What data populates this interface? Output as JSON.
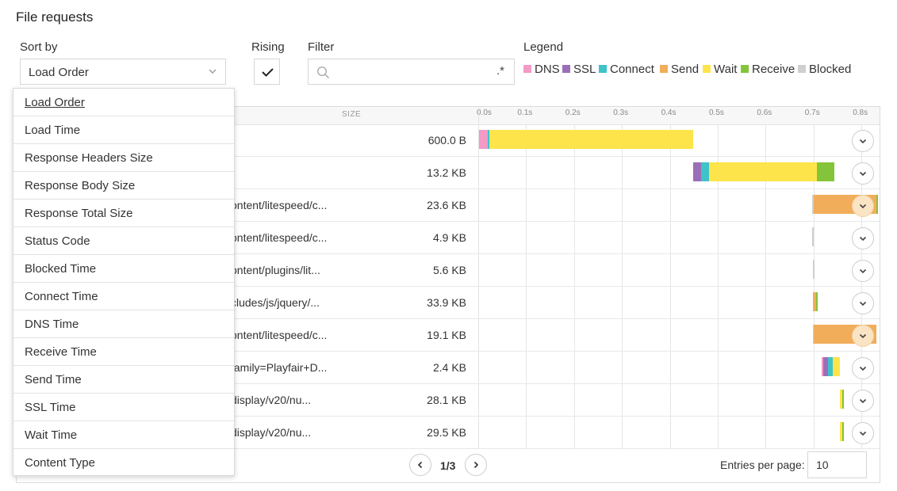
{
  "page": {
    "title": "File requests"
  },
  "controls": {
    "sort_label": "Sort by",
    "sort_value": "Load Order",
    "rising_label": "Rising",
    "rising_checked": true,
    "filter_label": "Filter",
    "filter_value": "",
    "filter_regex": ".*",
    "legend_label": "Legend"
  },
  "legend": [
    {
      "label": "DNS",
      "color": "#f39ac7"
    },
    {
      "label": "SSL",
      "color": "#9b6fb8"
    },
    {
      "label": "Connect",
      "color": "#3ec3c9"
    },
    {
      "label": "Send",
      "color": "#f2ad5a"
    },
    {
      "label": "Wait",
      "color": "#fde44a"
    },
    {
      "label": "Receive",
      "color": "#84c43a"
    },
    {
      "label": "Blocked",
      "color": "#cfcfcf"
    }
  ],
  "table": {
    "size_header": "SIZE",
    "ticks": [
      "0.0s",
      "0.1s",
      "0.2s",
      "0.3s",
      "0.4s",
      "0.5s",
      "0.6s",
      "0.7s",
      "0.8s"
    ],
    "rows": [
      {
        "url": "",
        "size": "600.0 B",
        "highlight": false,
        "timing": [
          {
            "phase": "DNS",
            "start": 0.0,
            "end": 0.018
          },
          {
            "phase": "Connect",
            "start": 0.018,
            "end": 0.021
          },
          {
            "phase": "Wait",
            "start": 0.021,
            "end": 0.447
          }
        ]
      },
      {
        "url": "",
        "size": "13.2 KB",
        "highlight": false,
        "timing": [
          {
            "phase": "SSL",
            "start": 0.447,
            "end": 0.463
          },
          {
            "phase": "Connect",
            "start": 0.463,
            "end": 0.48
          },
          {
            "phase": "Wait",
            "start": 0.48,
            "end": 0.705
          },
          {
            "phase": "Receive",
            "start": 0.705,
            "end": 0.742
          }
        ]
      },
      {
        "url": "ontent/litespeed/c...",
        "size": "23.6 KB",
        "highlight": true,
        "timing": [
          {
            "phase": "Blocked",
            "start": 0.696,
            "end": 0.698
          },
          {
            "phase": "Send",
            "start": 0.698,
            "end": 0.83
          },
          {
            "phase": "Receive",
            "start": 0.83,
            "end": 0.832
          }
        ]
      },
      {
        "url": "ontent/litespeed/c...",
        "size": "4.9 KB",
        "highlight": false,
        "timing": [
          {
            "phase": "Blocked",
            "start": 0.696,
            "end": 0.699
          }
        ]
      },
      {
        "url": "ontent/plugins/lit...",
        "size": "5.6 KB",
        "highlight": false,
        "timing": [
          {
            "phase": "Blocked",
            "start": 0.697,
            "end": 0.7
          }
        ]
      },
      {
        "url": "cludes/js/jquery/...",
        "size": "33.9 KB",
        "highlight": false,
        "timing": [
          {
            "phase": "Send",
            "start": 0.697,
            "end": 0.703
          },
          {
            "phase": "Receive",
            "start": 0.703,
            "end": 0.706
          }
        ]
      },
      {
        "url": "ontent/litespeed/c...",
        "size": "19.1 KB",
        "highlight": true,
        "timing": [
          {
            "phase": "Blocked",
            "start": 0.697,
            "end": 0.699
          },
          {
            "phase": "Send",
            "start": 0.699,
            "end": 0.83
          }
        ]
      },
      {
        "url": "family=Playfair+D...",
        "size": "2.4 KB",
        "highlight": false,
        "timing": [
          {
            "phase": "DNS",
            "start": 0.715,
            "end": 0.719
          },
          {
            "phase": "SSL",
            "start": 0.719,
            "end": 0.728
          },
          {
            "phase": "Connect",
            "start": 0.728,
            "end": 0.739
          },
          {
            "phase": "Wait",
            "start": 0.739,
            "end": 0.753
          }
        ]
      },
      {
        "url": "display/v20/nu...",
        "size": "28.1 KB",
        "highlight": false,
        "timing": [
          {
            "phase": "Wait",
            "start": 0.753,
            "end": 0.759
          },
          {
            "phase": "Receive",
            "start": 0.759,
            "end": 0.761
          }
        ]
      },
      {
        "url": "display/v20/nu...",
        "size": "29.5 KB",
        "highlight": false,
        "timing": [
          {
            "phase": "Wait",
            "start": 0.754,
            "end": 0.758
          },
          {
            "phase": "Receive",
            "start": 0.758,
            "end": 0.761
          }
        ]
      }
    ]
  },
  "pagination": {
    "page": "1/3",
    "entries_label": "Entries per page:",
    "entries_value": "10"
  },
  "dropdown": {
    "options": [
      "Load Order",
      "Load Time",
      "Response Headers Size",
      "Response Body Size",
      "Response Total Size",
      "Status Code",
      "Blocked Time",
      "Connect Time",
      "DNS Time",
      "Receive Time",
      "Send Time",
      "SSL Time",
      "Wait Time",
      "Content Type"
    ],
    "selected": "Load Order"
  }
}
